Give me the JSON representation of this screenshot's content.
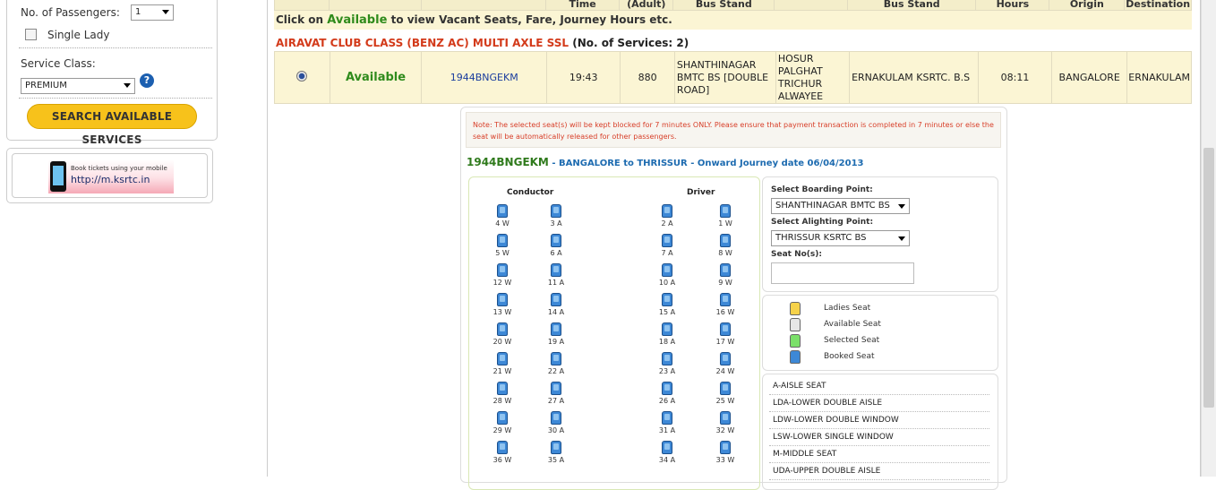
{
  "sidebar": {
    "passengers_label": "No. of Passengers:",
    "passengers_value": "1",
    "single_lady_label": "Single Lady",
    "service_class_label": "Service Class:",
    "service_class_value": "PREMIUM",
    "help": "?",
    "search_button": "SEARCH AVAILABLE SERVICES",
    "mobile_banner_small": "Book tickets using your mobile",
    "mobile_banner_url": "http://m.ksrtc.in"
  },
  "table": {
    "headers": [
      "",
      "",
      "",
      "Time",
      "(Adult)",
      "Bus Stand",
      "",
      "Bus Stand",
      "Hours",
      "Origin",
      "Destination"
    ],
    "note_prefix": "Click on",
    "note_available": "Available",
    "note_suffix": "to view Vacant Seats, Fare, Journey Hours etc.",
    "class_title": "AIRAVAT CLUB CLASS (BENZ AC) MULTI AXLE SSL",
    "class_services": "(No. of Services: 2)",
    "row": {
      "status": "Available",
      "service_code": "1944BNGEKM",
      "dep_time": "19:43",
      "fare": "880",
      "boarding_stand": "SHANTHINAGAR BMTC BS [DOUBLE ROAD]",
      "via": "HOSUR PALGHAT TRICHUR ALWAYEE",
      "arrival_stand": "ERNAKULAM KSRTC. B.S",
      "hours": "08:11",
      "origin": "BANGALORE",
      "destination": "ERNAKULAM"
    }
  },
  "booking": {
    "warning": "Note: The selected seat(s) will be kept blocked for 7 minutes ONLY. Please ensure that payment transaction is completed in 7 minutes or else the seat will be automatically released for other passengers.",
    "journey_code": "1944BNGEKM",
    "journey_desc": "- BANGALORE to THRISSUR - Onward Journey date 06/04/2013",
    "conductor_label": "Conductor",
    "driver_label": "Driver",
    "seat_rows": [
      [
        "4 W",
        "3 A",
        "2 A",
        "1 W"
      ],
      [
        "5 W",
        "6 A",
        "7 A",
        "8 W"
      ],
      [
        "12 W",
        "11 A",
        "10 A",
        "9 W"
      ],
      [
        "13 W",
        "14 A",
        "15 A",
        "16 W"
      ],
      [
        "20 W",
        "19 A",
        "18 A",
        "17 W"
      ],
      [
        "21 W",
        "22 A",
        "23 A",
        "24 W"
      ],
      [
        "28 W",
        "27 A",
        "26 A",
        "25 W"
      ],
      [
        "29 W",
        "30 A",
        "31 A",
        "32 W"
      ],
      [
        "36 W",
        "35 A",
        "34 A",
        "33 W"
      ]
    ],
    "boarding_label": "Select Boarding Point:",
    "boarding_value": "SHANTHINAGAR BMTC BS",
    "alighting_label": "Select Alighting Point:",
    "alighting_value": "THRISSUR KSRTC BS",
    "seat_no_label": "Seat No(s):",
    "legend": [
      {
        "label": "Ladies Seat",
        "color": "#f6d24a"
      },
      {
        "label": "Available Seat",
        "color": "#e6e6e6"
      },
      {
        "label": "Selected Seat",
        "color": "#7be06a"
      },
      {
        "label": "Booked Seat",
        "color": "#3d88d6"
      }
    ],
    "seat_types": [
      "A-AISLE SEAT",
      "LDA-LOWER DOUBLE AISLE",
      "LDW-LOWER DOUBLE WINDOW",
      "LSW-LOWER SINGLE WINDOW",
      "M-MIDDLE SEAT",
      "UDA-UPPER DOUBLE AISLE"
    ]
  }
}
